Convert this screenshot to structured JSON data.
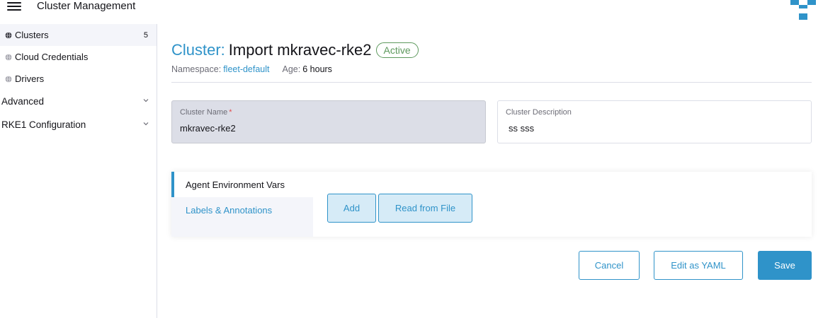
{
  "header": {
    "menu_icon": "hamburger-icon",
    "title": "Cluster Management",
    "logo_icon": "brand-logo-icon"
  },
  "sidebar": {
    "items": [
      {
        "label": "Clusters",
        "count": "5",
        "icon": "globe-icon",
        "active": true
      },
      {
        "label": "Cloud Credentials",
        "icon": "globe-icon"
      },
      {
        "label": "Drivers",
        "icon": "globe-icon"
      }
    ],
    "groups": [
      {
        "label": "Advanced",
        "icon": "chevron-down-icon"
      },
      {
        "label": "RKE1 Configuration",
        "icon": "chevron-down-icon"
      }
    ]
  },
  "main": {
    "title_prefix": "Cluster:",
    "title_name": "Import mkravec-rke2",
    "status": "Active",
    "namespace_label": "Namespace:",
    "namespace_value": "fleet-default",
    "age_label": "Age:",
    "age_value": "6 hours",
    "fields": {
      "name_label": "Cluster Name",
      "name_required": "*",
      "name_value": "mkravec-rke2",
      "description_label": "Cluster Description",
      "description_value": "ss sss"
    },
    "tabs": [
      {
        "label": "Agent Environment Vars",
        "active": true
      },
      {
        "label": "Labels & Annotations",
        "active": false
      }
    ],
    "tab_buttons": {
      "add": "Add",
      "read_from_file": "Read from File"
    },
    "footer_buttons": {
      "cancel": "Cancel",
      "edit_yaml": "Edit as YAML",
      "save": "Save"
    }
  },
  "colors": {
    "accent": "#2f93c9",
    "success": "#5d995d",
    "required": "#e24d4d",
    "disabled_bg": "#dcdee7"
  }
}
